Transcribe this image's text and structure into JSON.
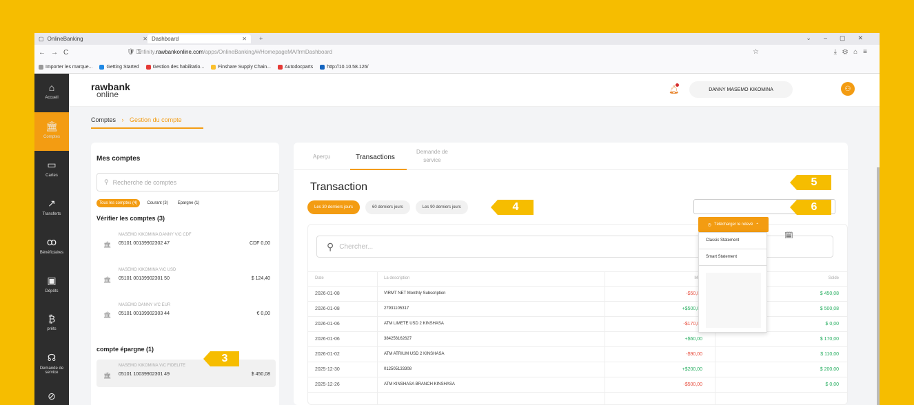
{
  "browser": {
    "tab1": "OnlineBanking",
    "tab2": "Dashboard",
    "url_prefix": "infinity.",
    "url_domain": "rawbankonline.com",
    "url_path": "/apps/OnlineBanking/#/HomepageMA/frmDashboard",
    "bookmarks": [
      "Importer les marque...",
      "Getting Started",
      "Gestion des habilitatio...",
      "Finshare Supply Chain...",
      "Autodocparts",
      "http://10.10.58.126/"
    ]
  },
  "sidebar": {
    "items": [
      {
        "label": "Accueil",
        "icon": "home-icon",
        "glyph": "⌂"
      },
      {
        "label": "Comptes",
        "icon": "bank-icon",
        "glyph": "🏛"
      },
      {
        "label": "Cartes",
        "icon": "card-icon",
        "glyph": "▭"
      },
      {
        "label": "Transferts",
        "icon": "transfer-icon",
        "glyph": "↗"
      },
      {
        "label": "Bénéficiaires",
        "icon": "beneficiaries-icon",
        "glyph": "ꝏ"
      },
      {
        "label": "Dépôts",
        "icon": "deposit-icon",
        "glyph": "▣"
      },
      {
        "label": "prêts",
        "icon": "loan-icon",
        "glyph": "₿"
      },
      {
        "label": "Demande de service",
        "icon": "service-icon",
        "glyph": "☊"
      }
    ]
  },
  "header": {
    "logo_top": "rawbank",
    "logo_bottom": "online",
    "user_name": "DANNY MASEMO KIKOMINA",
    "avatar_glyph": "⚇"
  },
  "breadcrumb": {
    "root": "Comptes",
    "current": "Gestion du compte"
  },
  "accounts": {
    "title": "Mes comptes",
    "search_placeholder": "Recherche de comptes",
    "chips": [
      "Tous les comptes (4)",
      "Courant (3)",
      "Epargne (1)"
    ],
    "verify_title": "Vérifier les comptes (3)",
    "items": [
      {
        "name": "MASEMO KIKOMINA DANNY V/C CDF",
        "number": "05101 00139902302 47",
        "balance": "CDF 0,00"
      },
      {
        "name": "MASEMO KIKOMINA V/C USD",
        "number": "05101 00139902301 50",
        "balance": "$ 124,40"
      },
      {
        "name": "MASEMO DANNY V/C EUR",
        "number": "05101 00139902303 44",
        "balance": "€ 0,00"
      }
    ],
    "savings_title": "compte épargne (1)",
    "savings_item": {
      "name": "MASEMO KIKOMINA V/C FIDELITE",
      "number": "05101 10039902301 49",
      "balance": "$ 450,08"
    }
  },
  "main": {
    "tabs": [
      "Aperçu",
      "Transactions",
      "Demande de",
      "service"
    ],
    "title": "Transaction",
    "periods": [
      "Les 30 derniers jours",
      "60 derniers jours",
      "Les 90 derniers jours"
    ],
    "search_placeholder": "Chercher...",
    "columns": [
      "Date",
      "La description",
      "Mon",
      "Solde"
    ],
    "rows": [
      {
        "date": "2026-01-08",
        "desc": "VIRMT NET Monthly Subscription",
        "amount": "-$50,00",
        "balance": "$ 450,08",
        "sign": "neg"
      },
      {
        "date": "2026-01-08",
        "desc": "27931105317",
        "amount": "+$500,08",
        "balance": "$ 500,08",
        "sign": "pos"
      },
      {
        "date": "2026-01-06",
        "desc": "ATM LIMETE USD 2 KINSHASA",
        "amount": "-$170,00",
        "balance": "$ 0,00",
        "sign": "neg"
      },
      {
        "date": "2026-01-06",
        "desc": "384256162627",
        "amount": "+$60,00",
        "balance": "$ 170,00",
        "sign": "pos"
      },
      {
        "date": "2026-01-02",
        "desc": "ATM ATRIUM USD 2 KINSHASA",
        "amount": "-$90,00",
        "balance": "$ 110,00",
        "sign": "neg"
      },
      {
        "date": "2025-12-30",
        "desc": "012505133308",
        "amount": "+$200,00",
        "balance": "$ 200,00",
        "sign": "pos"
      },
      {
        "date": "2025-12-26",
        "desc": "ATM KINSHASA BRANCH KINSHASA",
        "amount": "-$500,00",
        "balance": "$ 0,00",
        "sign": "neg"
      }
    ]
  },
  "download": {
    "button": "Télécharger le relevé",
    "options": [
      "Classic Statement",
      "Smart Statement"
    ]
  },
  "callouts": [
    "3",
    "4",
    "5",
    "6"
  ],
  "colors": {
    "accent": "#f39c12",
    "frame": "#f6bd00",
    "negative": "#e74c3c",
    "positive": "#27ae60",
    "sidebar": "#2d2d2d"
  }
}
